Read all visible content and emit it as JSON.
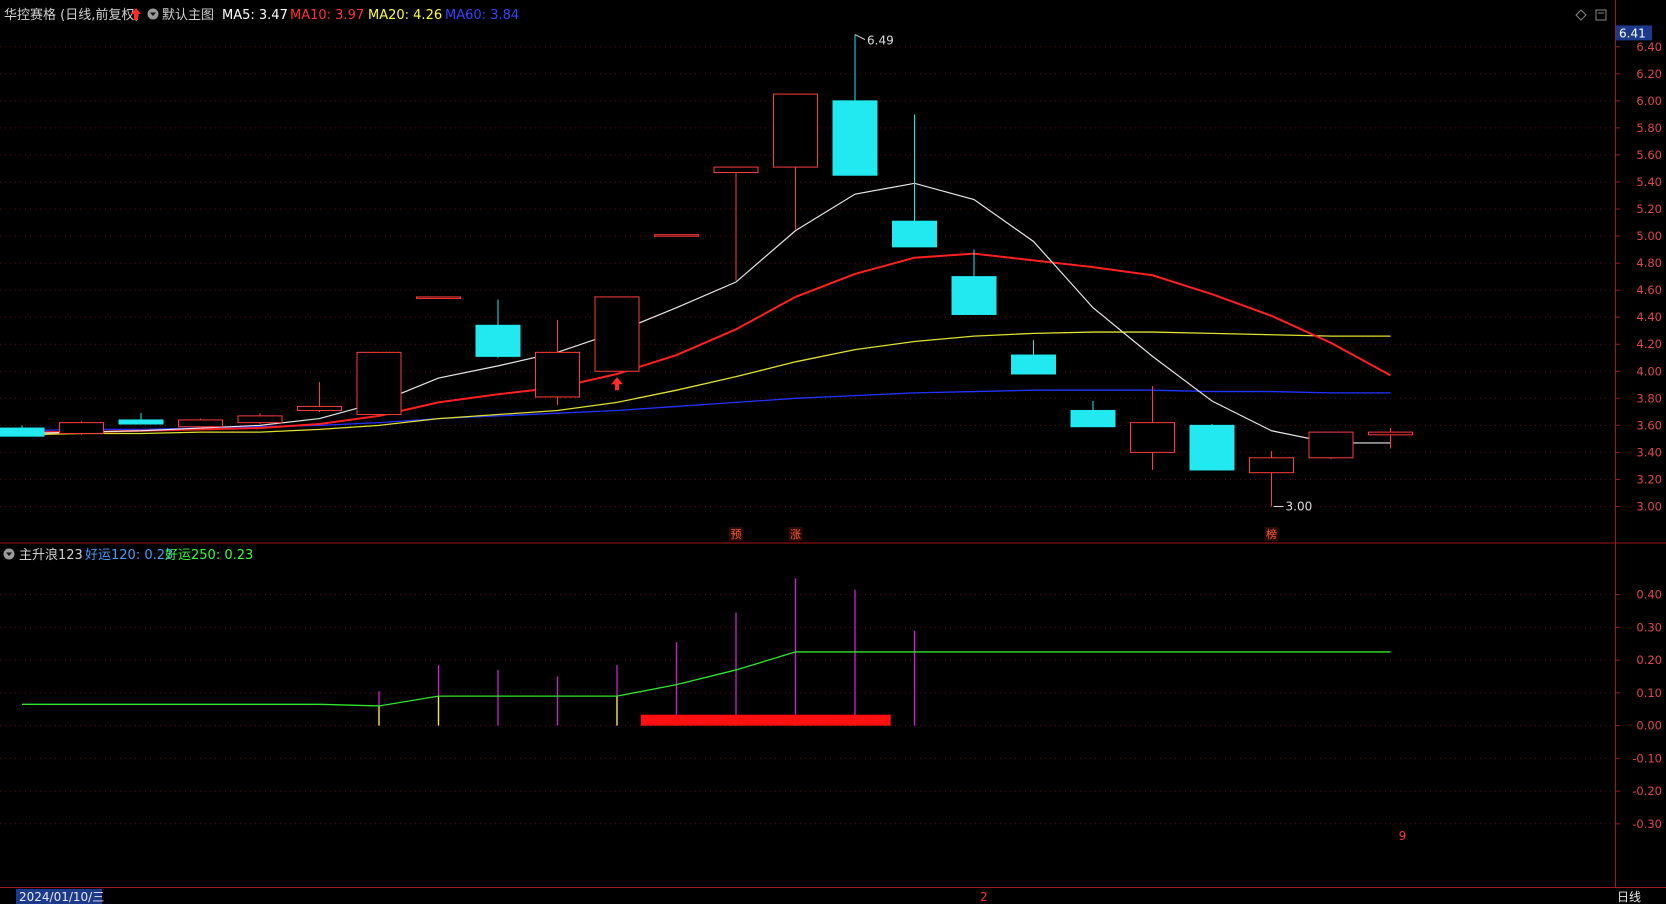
{
  "header": {
    "stock_name": "华控赛格",
    "period": "(日线,前复权)",
    "main_chart_label": "默认主图",
    "ma": [
      {
        "label": "MA5:",
        "value": "3.47",
        "color": "#ffffff"
      },
      {
        "label": "MA10:",
        "value": "3.97",
        "color": "#ff3333"
      },
      {
        "label": "MA20:",
        "value": "4.26",
        "color": "#ffff33"
      },
      {
        "label": "MA60:",
        "value": "3.84",
        "color": "#3344ff"
      }
    ]
  },
  "sub_header": {
    "indicator": "主升浪123",
    "lines": [
      {
        "label": "好运120:",
        "value": "0.23",
        "color": "#4a9cff"
      },
      {
        "label": "好运250:",
        "value": "0.23",
        "color": "#33ff33"
      }
    ]
  },
  "price_axis": {
    "current_price": "6.41",
    "ticks": [
      "6.40",
      "6.20",
      "6.00",
      "5.80",
      "5.60",
      "5.40",
      "5.20",
      "5.00",
      "4.80",
      "4.60",
      "4.40",
      "4.20",
      "4.00",
      "3.80",
      "3.60",
      "3.40",
      "3.20",
      "3.00"
    ]
  },
  "indicator_axis": {
    "ticks": [
      "0.40",
      "0.30",
      "0.20",
      "0.10",
      "0.00",
      "-0.10",
      "-0.20",
      "-0.30"
    ]
  },
  "annotations": {
    "high": "6.49",
    "low": "3.00",
    "markers": [
      "预",
      "涨",
      "榜"
    ],
    "sub_marker": "9",
    "bottom_marker": "2"
  },
  "footer": {
    "date": "2024/01/10/三",
    "period_button": "日线"
  },
  "chart_data": {
    "type": "candlestick",
    "price_range": [
      2.9,
      6.45
    ],
    "candles": [
      {
        "o": 3.58,
        "h": 3.6,
        "l": 3.52,
        "c": 3.52
      },
      {
        "o": 3.54,
        "h": 3.63,
        "l": 3.53,
        "c": 3.62
      },
      {
        "o": 3.64,
        "h": 3.69,
        "l": 3.62,
        "c": 3.61
      },
      {
        "o": 3.59,
        "h": 3.65,
        "l": 3.58,
        "c": 3.64
      },
      {
        "o": 3.62,
        "h": 3.69,
        "l": 3.61,
        "c": 3.67
      },
      {
        "o": 3.71,
        "h": 3.92,
        "l": 3.7,
        "c": 3.74
      },
      {
        "o": 3.68,
        "h": 4.14,
        "l": 3.68,
        "c": 4.14
      },
      {
        "o": 4.55,
        "h": 4.55,
        "l": 4.55,
        "c": 4.55
      },
      {
        "o": 4.34,
        "h": 4.53,
        "l": 4.1,
        "c": 4.11
      },
      {
        "o": 3.81,
        "h": 4.38,
        "l": 3.75,
        "c": 4.14
      },
      {
        "o": 4.0,
        "h": 4.55,
        "l": 4.0,
        "c": 4.55
      },
      {
        "o": 5.01,
        "h": 5.01,
        "l": 5.01,
        "c": 5.01
      },
      {
        "o": 5.47,
        "h": 5.51,
        "l": 4.67,
        "c": 5.51
      },
      {
        "o": 5.51,
        "h": 6.05,
        "l": 5.05,
        "c": 6.05
      },
      {
        "o": 6.0,
        "h": 6.49,
        "l": 5.45,
        "c": 5.45
      },
      {
        "o": 5.11,
        "h": 5.9,
        "l": 4.92,
        "c": 4.92
      },
      {
        "o": 4.7,
        "h": 4.9,
        "l": 4.42,
        "c": 4.42
      },
      {
        "o": 4.12,
        "h": 4.23,
        "l": 3.98,
        "c": 3.98
      },
      {
        "o": 3.71,
        "h": 3.78,
        "l": 3.59,
        "c": 3.59
      },
      {
        "o": 3.4,
        "h": 3.89,
        "l": 3.27,
        "c": 3.62
      },
      {
        "o": 3.6,
        "h": 3.61,
        "l": 3.27,
        "c": 3.27
      },
      {
        "o": 3.25,
        "h": 3.41,
        "l": 3.0,
        "c": 3.36
      },
      {
        "o": 3.36,
        "h": 3.55,
        "l": 3.35,
        "c": 3.55
      },
      {
        "o": 3.53,
        "h": 3.58,
        "l": 3.43,
        "c": 3.55
      }
    ],
    "ma5": [
      3.54,
      3.55,
      3.56,
      3.58,
      3.6,
      3.65,
      3.77,
      3.95,
      4.04,
      4.14,
      4.29,
      4.47,
      4.66,
      5.04,
      5.31,
      5.39,
      5.27,
      4.96,
      4.47,
      4.11,
      3.78,
      3.56,
      3.47,
      3.47
    ],
    "ma10": [
      3.55,
      3.55,
      3.56,
      3.57,
      3.58,
      3.61,
      3.67,
      3.77,
      3.83,
      3.88,
      3.98,
      4.12,
      4.31,
      4.55,
      4.72,
      4.84,
      4.87,
      4.82,
      4.77,
      4.71,
      4.57,
      4.41,
      4.21,
      3.97
    ],
    "ma20": [
      3.53,
      3.54,
      3.54,
      3.55,
      3.55,
      3.57,
      3.6,
      3.65,
      3.68,
      3.71,
      3.77,
      3.86,
      3.96,
      4.07,
      4.16,
      4.22,
      4.26,
      4.28,
      4.29,
      4.29,
      4.28,
      4.27,
      4.26,
      4.26
    ],
    "ma60": [
      3.56,
      3.57,
      3.57,
      3.58,
      3.59,
      3.6,
      3.62,
      3.65,
      3.67,
      3.69,
      3.71,
      3.74,
      3.77,
      3.8,
      3.82,
      3.84,
      3.85,
      3.86,
      3.86,
      3.86,
      3.85,
      3.85,
      3.84,
      3.84
    ],
    "indicator_range": [
      -0.38,
      0.46
    ],
    "haoyun": [
      0.065,
      0.065,
      0.065,
      0.065,
      0.065,
      0.065,
      0.06,
      0.09,
      0.09,
      0.09,
      0.09,
      0.125,
      0.17,
      0.225,
      0.225,
      0.225,
      0.225,
      0.225,
      0.225,
      0.225,
      0.225,
      0.225,
      0.225,
      0.225
    ],
    "purple_bars": [
      0,
      0,
      0,
      0,
      0,
      0,
      0.105,
      0.185,
      0.17,
      0.15,
      0.185,
      0.255,
      0.345,
      0.45,
      0.415,
      0.29,
      0,
      0,
      0,
      0,
      0,
      0,
      0,
      0
    ],
    "yellow_bars": [
      0,
      0,
      0,
      0,
      0,
      0,
      0.06,
      0.09,
      0,
      0,
      0.09,
      0.03,
      0.03,
      0.03,
      0,
      0,
      0,
      0,
      0,
      0,
      0,
      0,
      0,
      0
    ],
    "red_band": {
      "from": 10.4,
      "to": 14.6,
      "value": 0.015
    }
  }
}
